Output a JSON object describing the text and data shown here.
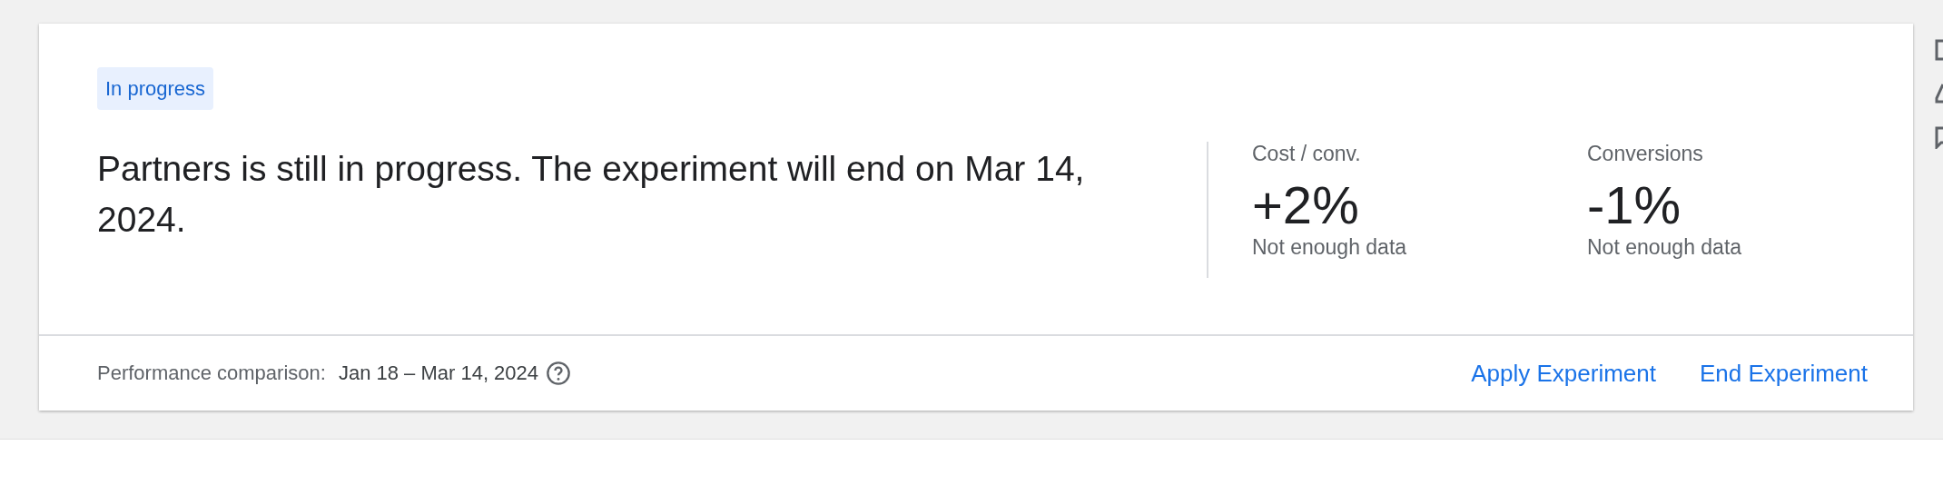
{
  "status_badge": "In progress",
  "message": "Partners is still in progress. The experiment will end on Mar 14, 2024.",
  "metrics": [
    {
      "label": "Cost / conv.",
      "value": "+2%",
      "note": "Not enough data"
    },
    {
      "label": "Conversions",
      "value": "-1%",
      "note": "Not enough data"
    }
  ],
  "footer": {
    "comparison_label": "Performance comparison:",
    "date_range": "Jan 18 – Mar 14, 2024",
    "actions": [
      "Apply Experiment",
      "End Experiment"
    ]
  }
}
